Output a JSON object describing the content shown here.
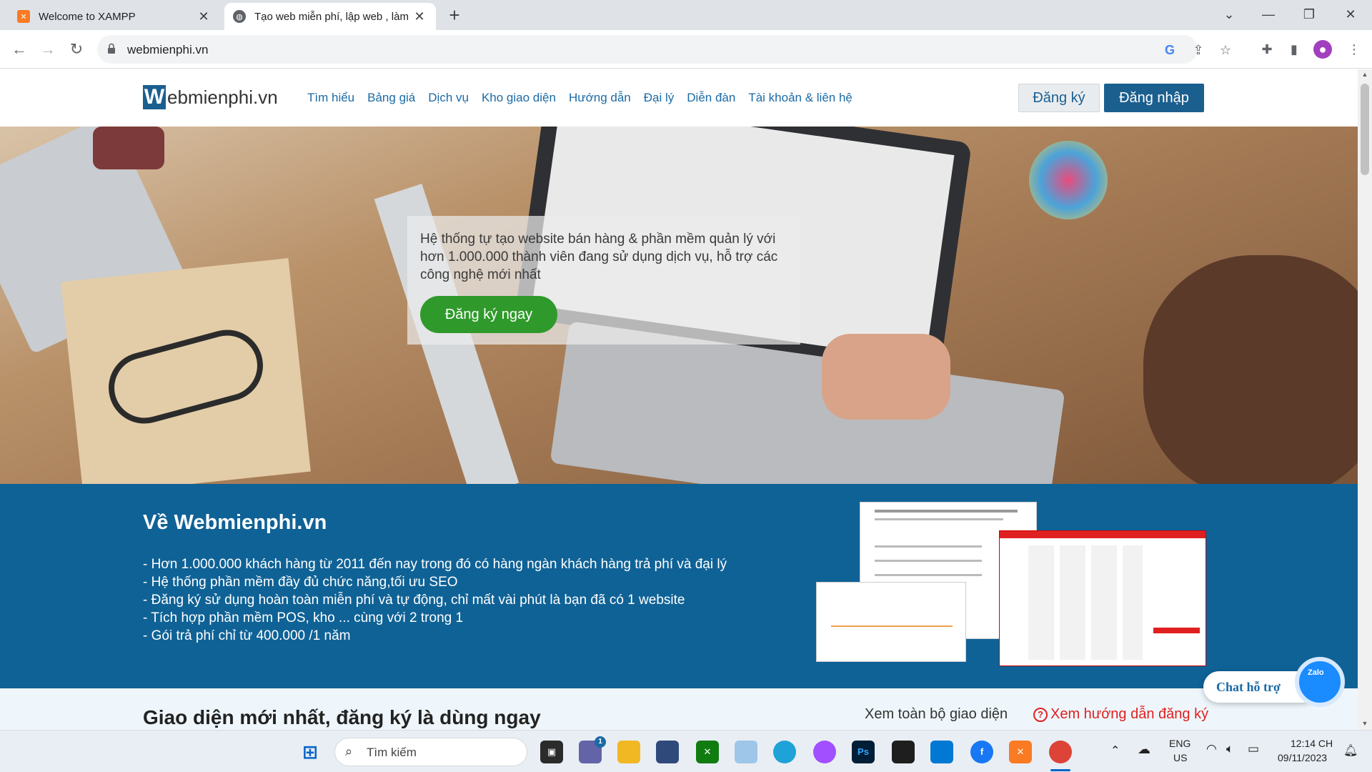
{
  "browser": {
    "tabs": [
      {
        "title": "Welcome to XAMPP",
        "icon": "xampp-icon"
      },
      {
        "title": "Tạo web miễn phí, lập web , làm",
        "icon": "globe-icon"
      }
    ],
    "url": "webmienphi.vn"
  },
  "site": {
    "logo_w": "W",
    "logo_rest": "ebmienphi.vn",
    "nav": [
      "Tìm hiểu",
      "Bảng giá",
      "Dịch vụ",
      "Kho giao diện",
      "Hướng dẫn",
      "Đại lý",
      "Diễn đàn",
      "Tài khoản & liên hệ"
    ],
    "register_label": "Đăng ký",
    "login_label": "Đăng nhập"
  },
  "hero": {
    "text": "Hệ thống tự tạo website bán hàng & phần mềm quản lý với hơn 1.000.000 thành viên đang sử dụng dịch vụ, hỗ trợ các công nghệ mới nhất",
    "cta": "Đăng ký ngay"
  },
  "about": {
    "title": "Về Webmienphi.vn",
    "items": [
      "- Hơn 1.000.000 khách hàng từ 2011 đến nay trong đó có hàng ngàn khách hàng trả phí và đại lý",
      "- Hệ thống phần mềm đầy đủ chức năng,tối ưu SEO",
      "- Đăng ký sử dụng hoàn toàn miễn phí và tự động, chỉ mất vài phút là bạn đã có 1 website",
      "- Tích hợp phần mềm POS, kho ... cùng với 2 trong 1",
      "- Gói trả phí chỉ từ 400.000 /1 năm"
    ]
  },
  "themes": {
    "title": "Giao diện mới nhất, đăng ký là dùng ngay",
    "view_all": "Xem toàn bộ giao diện",
    "guide": "Xem hướng dẫn đăng ký"
  },
  "chat": {
    "label": "Chat hỗ trợ",
    "bubble": "Zalo"
  },
  "taskbar": {
    "search_label": "Tìm kiếm",
    "lang_1": "ENG",
    "lang_2": "US",
    "time": "12:14 CH",
    "date": "09/11/2023",
    "teams_badge": "1",
    "photoshop_label": "Ps"
  },
  "colors": {
    "brand": "#1b5f8f",
    "cta_green": "#2f9a2b",
    "about_bg": "#0f6296",
    "link_red": "#e02020"
  }
}
